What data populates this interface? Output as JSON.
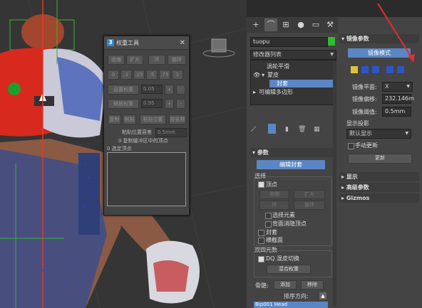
{
  "weight_tool": {
    "title": "权重工具",
    "row1": [
      "收缩",
      "扩大",
      "环",
      "循环"
    ],
    "presets": [
      "0",
      ".1",
      ".25",
      ".5",
      ".75",
      "1"
    ],
    "set_weight": "设置权重",
    "set_weight_val": "0.05",
    "scale_weight": "缩放权重",
    "scale_weight_val": "0.95",
    "row4": [
      "复制",
      "粘贴",
      "粘贴位置",
      "按名称"
    ],
    "paste_tolerance_label": "粘贴位置容差",
    "paste_tolerance_val": "0.5mm",
    "copied_label": "0 复制缓冲区中的顶点",
    "selected_label": "0 选定顶点",
    "plus": "+",
    "minus": "-"
  },
  "command_panel": {
    "object_name": "tuopu",
    "modifier_list": "修改器列表",
    "stack": [
      "涡轮平滑",
      "蒙皮",
      "封套",
      "可编辑多边形"
    ],
    "params_title": "参数",
    "edit_envelope": "编辑封套",
    "select_label": "选择",
    "vertices_label": "顶点",
    "grow": "收缩",
    "expand": "扩大",
    "ring": "环",
    "loop": "循环",
    "select_element": "选择元素",
    "backface_cull": "背面消隐顶点",
    "envelope": "封套",
    "cross_section": "横截面",
    "dual_quat": "双四元数",
    "dq_toggle": "DQ 混皮切换",
    "blend_weights": "混合权重",
    "bones_label": "骨骼:",
    "add": "添加",
    "remove": "移除",
    "sort_label": "排序方向:",
    "bone_item": "Bip001 Head"
  },
  "side_panel": {
    "mirror_title": "镜像参数",
    "mirror_mode": "镜像模式",
    "mirror_plane_label": "镜像平面:",
    "mirror_plane": "X",
    "mirror_offset_label": "镜像偏移:",
    "mirror_offset": "232.146m",
    "mirror_threshold_label": "镜像阈值:",
    "mirror_threshold": "0.5mm",
    "display_proj_label": "显示投影",
    "display_proj": "默认显示",
    "manual_update": "手动更新",
    "update": "更新",
    "display": "显示",
    "advanced": "高级参数",
    "gizmos": "Gizmos"
  },
  "colors": {
    "accent": "#5b86c4",
    "stack_selected": "#5b86c4",
    "red_arrow": "#e03030"
  }
}
